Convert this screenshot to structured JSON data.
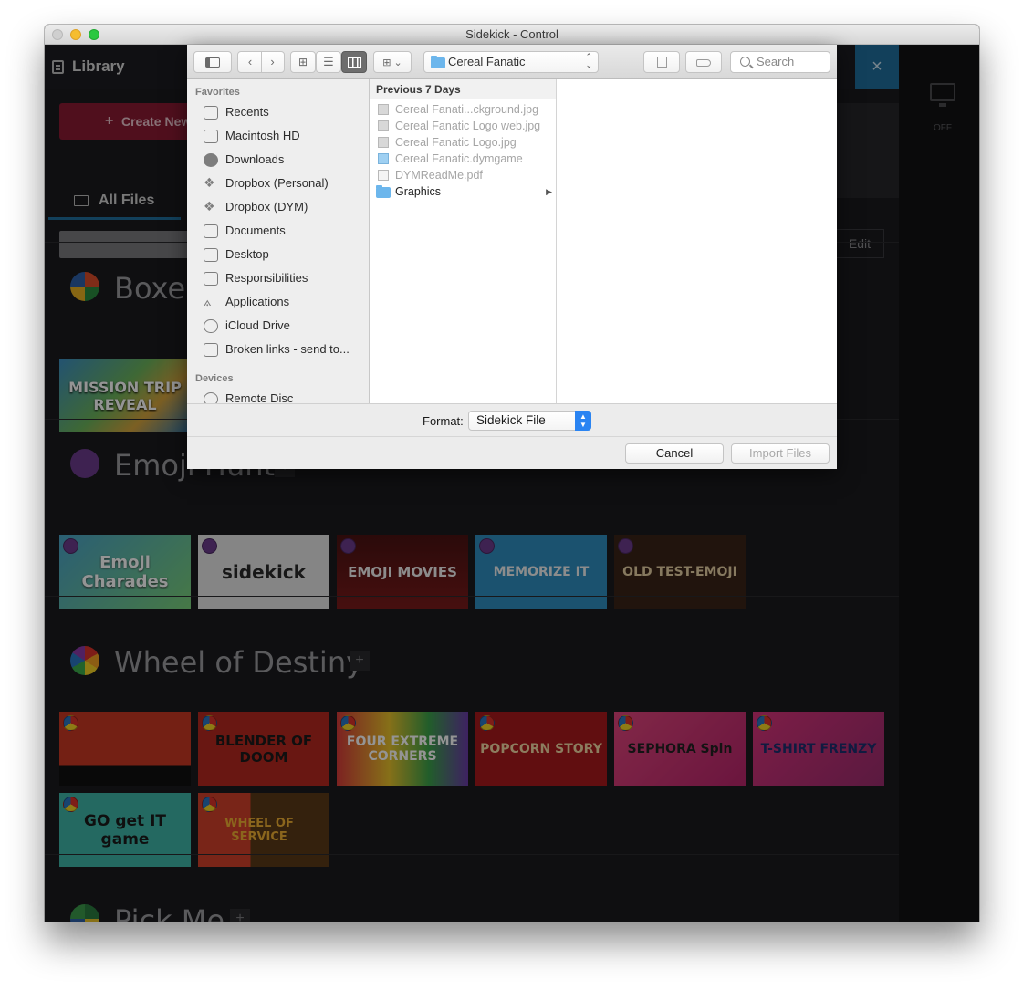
{
  "window": {
    "title": "Sidekick - Control"
  },
  "app": {
    "library_title": "Library",
    "close_symbol": "×",
    "create_label": "Create New",
    "all_files_label": "All Files",
    "edit_label": "Edit",
    "display_status": "OFF",
    "add_symbol": "+",
    "sections": [
      {
        "title": "Boxes"
      },
      {
        "title": "Emoji Hunt"
      },
      {
        "title": "Wheel of Destiny"
      },
      {
        "title": "Pick Me"
      }
    ],
    "thumbnails": {
      "boxes": [
        "MISSION TRIP REVEAL"
      ],
      "emoji": [
        "Emoji Charades",
        "sidekick",
        "EMOJI MOVIES",
        "MEMORIZE IT",
        "OLD TEST-EMOJI"
      ],
      "wheel_row1": [
        "",
        "BLENDER OF DOOM",
        "FOUR EXTREME CORNERS",
        "POPCORN STORY",
        "SEPHORA Spin",
        "T-SHIRT FRENZY"
      ],
      "wheel_row2": [
        "GO get IT game",
        "WHEEL OF SERVICE"
      ]
    }
  },
  "dialog": {
    "current_folder": "Cereal Fanatic",
    "search_placeholder": "Search",
    "sidebar": {
      "favorites_header": "Favorites",
      "favorites": [
        "Recents",
        "Macintosh HD",
        "Downloads",
        "Dropbox (Personal)",
        "Dropbox (DYM)",
        "Documents",
        "Desktop",
        "Responsibilities",
        "Applications",
        "iCloud Drive",
        "Broken links - send to..."
      ],
      "devices_header": "Devices",
      "devices": [
        "Remote Disc"
      ]
    },
    "column_header": "Previous 7 Days",
    "files": [
      {
        "name": "Cereal Fanati...ckground.jpg",
        "enabled": false
      },
      {
        "name": "Cereal Fanatic Logo web.jpg",
        "enabled": false
      },
      {
        "name": "Cereal Fanatic Logo.jpg",
        "enabled": false
      },
      {
        "name": "Cereal Fanatic.dymgame",
        "enabled": false
      },
      {
        "name": "DYMReadMe.pdf",
        "enabled": false
      },
      {
        "name": "Graphics",
        "enabled": true,
        "type": "folder"
      }
    ],
    "format_label": "Format:",
    "format_value": "Sidekick File",
    "cancel_label": "Cancel",
    "import_label": "Import Files"
  }
}
